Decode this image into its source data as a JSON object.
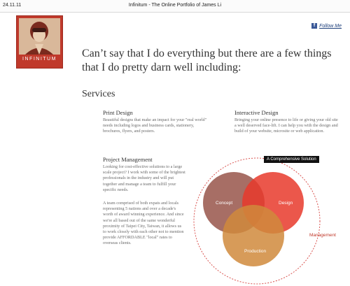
{
  "topbar": {
    "date": "24.11.11",
    "title": "Infinitum - The Online Portfolio of James Li"
  },
  "logo": {
    "wordmark": "INFINITUM"
  },
  "follow": {
    "icon": "f",
    "label": "Follow Me"
  },
  "headline": "Can’t say that I do everything but there are a few things that I do pretty darn well including:",
  "services_heading": "Services",
  "services": [
    {
      "title": "Print Design",
      "desc": "Beautiful designs that make an impact for your \"real world\" needs including logos and business cards, stationery, brochures, flyers, and posters."
    },
    {
      "title": "Interactive Design",
      "desc": "Bringing your online presence to life or giving your old site a well deserved face-lift. I can help you with the design and build of your website, microsite or web application."
    },
    {
      "title": "Project Management",
      "desc": "Looking for cost-effective solutions to a large scale project? I work with some of the brightest professionals in the industry and will put together and manage a team to fulfill your specific needs.",
      "desc2": "A team comprised of both expats and locals representing 5 nations and over a decade's worth of award winning experience. And since we're all based out of the same wonderful proximity of Taipei City, Taiwan, it allows us to work closely with each other not to mention provide AFFORDABLE \"local\" rates to overseas clients."
    }
  ],
  "diagram": {
    "badge": "A Comprehensive Solution",
    "outer_label": "Management",
    "circles": [
      "Concept",
      "Design",
      "Production"
    ],
    "colors": {
      "concept": "#9b5a50",
      "design": "#e8392c",
      "production": "#d0893c",
      "ring": "#d9534f"
    }
  }
}
